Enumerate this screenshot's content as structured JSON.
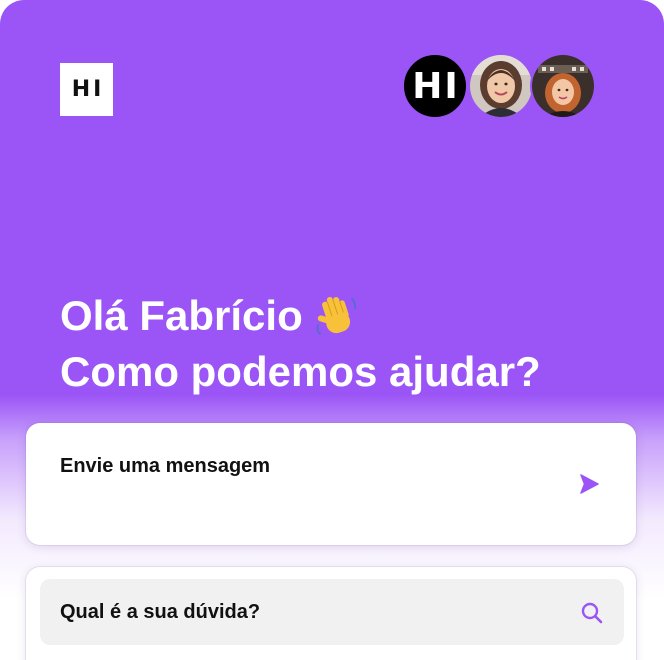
{
  "header": {
    "logo_text": "HI",
    "avatars": [
      {
        "label": "HI",
        "kind": "brand-avatar"
      },
      {
        "kind": "team-member-avatar"
      },
      {
        "kind": "team-member-avatar"
      }
    ]
  },
  "greeting": {
    "line1": "Olá Fabrício",
    "line2": "Como podemos ajudar?",
    "emoji_icon": "waving-hand-icon"
  },
  "message_card": {
    "label": "Envie uma mensagem",
    "icon": "send-icon"
  },
  "search": {
    "placeholder": "Qual é a sua dúvida?",
    "icon": "search-icon"
  },
  "colors": {
    "brand_purple": "#9b55f6",
    "accent_purple": "#9b55f6",
    "card_bg": "#ffffff",
    "search_bg": "#f1f1f2",
    "text_dark": "#111111"
  }
}
